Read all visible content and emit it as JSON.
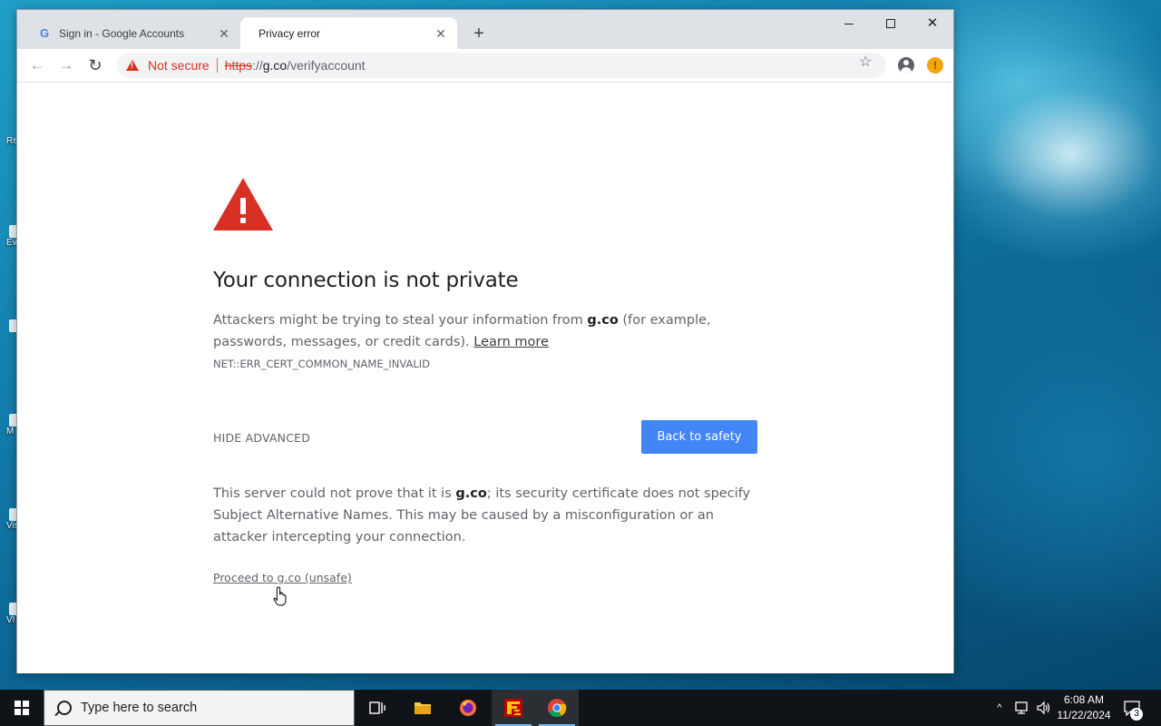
{
  "browser": {
    "tabs": [
      {
        "title": "Sign in - Google Accounts",
        "favicon": "G"
      },
      {
        "title": "Privacy error"
      }
    ],
    "tab_close_glyph": "✕",
    "new_tab_glyph": "+",
    "omnibox": {
      "security_label": "Not secure",
      "url_scheme": "https",
      "url_sep": "://",
      "url_host": "g.co",
      "url_path": "/verifyaccount"
    },
    "window_controls": {
      "close": "✕"
    },
    "ext_badge": "!"
  },
  "page": {
    "heading": "Your connection is not private",
    "p1_before": "Attackers might be trying to steal your information from ",
    "p1_host": "g.co",
    "p1_after": " (for example, passwords, messages, or credit cards). ",
    "learn_more": "Learn more",
    "error_code": "NET::ERR_CERT_COMMON_NAME_INVALID",
    "hide_advanced": "HIDE ADVANCED",
    "back_button": "Back to safety",
    "p2_before": "This server could not prove that it is ",
    "p2_host": "g.co",
    "p2_after": "; its security certificate does not specify Subject Alternative Names. This may be caused by a misconfiguration or an attacker intercepting your connection.",
    "proceed_link": "Proceed to g.co (unsafe)"
  },
  "desktop": {
    "icons": [
      "Re",
      "Ev",
      "",
      "M",
      "Vis",
      "VI"
    ]
  },
  "taskbar": {
    "search_placeholder": "Type here to search",
    "clock_time": "6:08 AM",
    "clock_date": "11/22/2024",
    "notification_count": "3",
    "apps": [
      "task-view",
      "file-explorer",
      "firefox",
      "filezilla",
      "chrome"
    ]
  },
  "colors": {
    "danger": "#d93025",
    "primary_button": "#4285f4",
    "taskbar": "#101418"
  }
}
